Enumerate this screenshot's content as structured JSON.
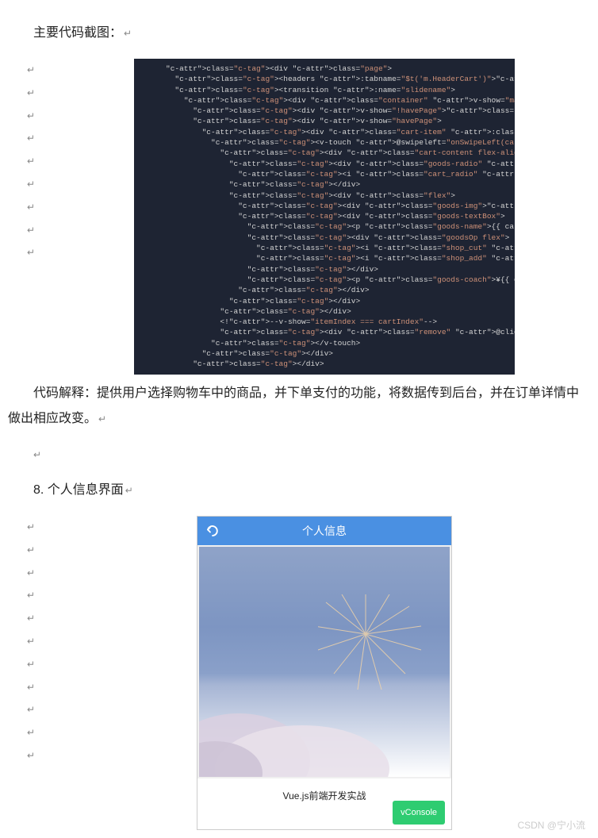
{
  "doc": {
    "heading1": "主要代码截图：",
    "return": "↵",
    "code_lines": [
      "<div class=\"page\">",
      "  <headers :tabname=\"$t('m.HeaderCart')\"></headers>",
      "  <transition :name=\"slidename\">",
      "    <div class=\"container\" v-show=\"mainarea\">",
      "      <div v-show=\"!havePage\"><nopage></nopage></div>",
      "      <div v-show=\"havePage\">",
      "        <div class=\"cart-item\" :class=\"{ selected: itemIndex === cartIndex }\" v-for=\"(cartItem, cartIndex) in $store.state.carts\" :key=",
      "          <v-touch @swipeleft=\"onSwipeLeft(cartIndex)\" @swiperight=\"onSwipeRight(cartIndex)\">",
      "            <div class=\"cart-content flex-align-center\">",
      "              <div class=\"goods-radio\" @click.stop=\"onGoodsRadio(cartItem)\">",
      "                <i class=\"cart_radio\" v-show=\"!cartItem.goodsRadio\"></i> <i class=\"cart_radio_select\" v-show=\"cartItem.goodsRadio\"",
      "              </div>",
      "              <div class=\"flex\">",
      "                <div class=\"goods-img\"><img v-lazy=\"cartItem.GoodsImage\" /></div>",
      "                <div class=\"goods-textBox\">",
      "                  <p class=\"goods-name\">{{ cartItem.GoodsName }}</p>",
      "                  <div class=\"goodsOp flex\">",
      "                    <i class=\"shop_cut\" @click.stop=\"onCutCart(cartItem)\"></i> <input type=\"text\" :value=\"cartItem.GoodsNum",
      "                    <i class=\"shop_add\" @click.stop=\"onAddCart(cartItem)\"></i>",
      "                  </div>",
      "                  <p class=\"goods-coach\">¥{{ cartItem.GoodsPrice }}</p>",
      "                </div>",
      "              </div>",
      "            </div>",
      "            <!--v-show=\"itemIndex === cartIndex\"-->",
      "            <div class=\"remove\" @click.stop=\"onRemove(cartItem)\"></div></div>",
      "          </v-touch>",
      "        </div>",
      "      </div>"
    ],
    "explain": "代码解释：提供用户选择购物车中的商品，并下单支付的功能，将数据传到后台，并在订单详情中做出相应改变。",
    "heading2": "8. 个人信息界面",
    "phone": {
      "title": "个人信息",
      "caption": "Vue.js前端开发实战",
      "vconsole": "vConsole"
    }
  },
  "watermark": "CSDN @宁小流"
}
